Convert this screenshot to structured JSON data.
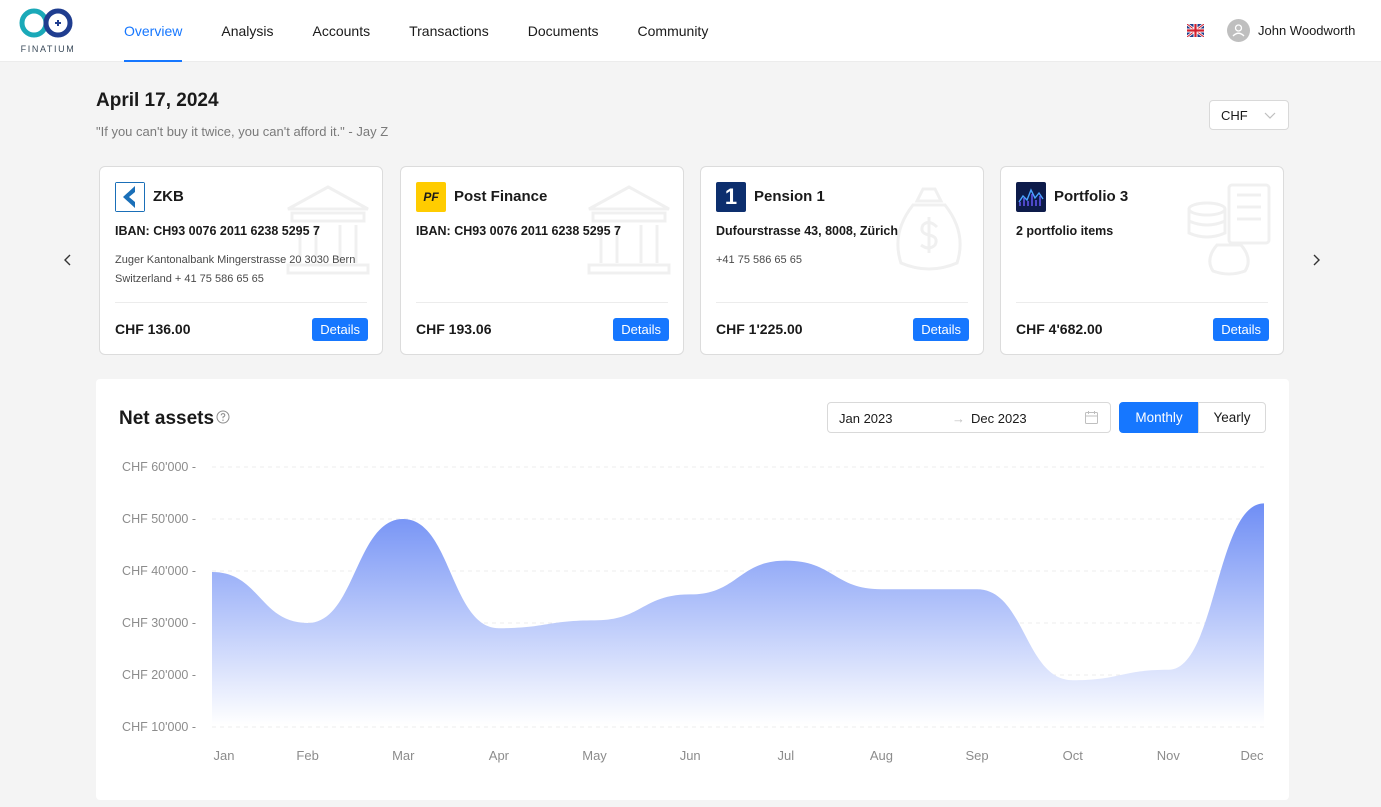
{
  "brand": {
    "name": "FINATIUM"
  },
  "nav": {
    "items": [
      {
        "label": "Overview",
        "active": true
      },
      {
        "label": "Analysis",
        "active": false
      },
      {
        "label": "Accounts",
        "active": false
      },
      {
        "label": "Transactions",
        "active": false
      },
      {
        "label": "Documents",
        "active": false
      },
      {
        "label": "Community",
        "active": false
      }
    ]
  },
  "user": {
    "name": "John Woodworth",
    "language_icon": "uk-flag-icon"
  },
  "header": {
    "date": "April 17, 2024",
    "quote": "\"If you can't buy it twice, you can't afford it.\" - Jay Z",
    "currency": "CHF"
  },
  "cards": [
    {
      "title": "ZKB",
      "line1": "IBAN: CH93 0076 2011 6238 5295 7",
      "line2": "Zuger Kantonalbank Mingerstrasse 20 3030 Bern Switzerland + 41 75 586 65 65",
      "amount": "CHF 136.00",
      "button": "Details",
      "icon": "zkb-logo-icon"
    },
    {
      "title": "Post Finance",
      "line1": "IBAN: CH93 0076 2011 6238 5295 7",
      "line2": "",
      "amount": "CHF 193.06",
      "button": "Details",
      "icon": "postfinance-logo-icon",
      "logo_text": "PF"
    },
    {
      "title": "Pension 1",
      "line1": "Dufourstrasse 43, 8008, Zürich",
      "line2": "+41 75 586 65 65",
      "amount": "CHF 1'225.00",
      "button": "Details",
      "icon": "pension-logo-icon",
      "logo_text": "1"
    },
    {
      "title": "Portfolio 3",
      "line1": "2 portfolio items",
      "line2": "",
      "amount": "CHF 4'682.00",
      "button": "Details",
      "icon": "portfolio-logo-icon"
    }
  ],
  "panel": {
    "title": "Net assets",
    "range_start": "Jan 2023",
    "range_arrow": "→",
    "range_end": "Dec 2023",
    "segments": [
      "Monthly",
      "Yearly"
    ],
    "selected_segment": "Monthly"
  },
  "colors": {
    "accent": "#1677ff",
    "area_top": "#6f8ef5",
    "area_bottom": "#ffffff"
  },
  "chart_data": {
    "type": "area",
    "categories": [
      "Jan",
      "Feb",
      "Mar",
      "Apr",
      "May",
      "Jun",
      "Jul",
      "Aug",
      "Sep",
      "Oct",
      "Nov",
      "Dec"
    ],
    "values": [
      39800,
      30000,
      50000,
      29000,
      30500,
      35500,
      42000,
      36500,
      36500,
      19000,
      21000,
      53000
    ],
    "yticks": [
      "CHF 60'000",
      "CHF 50'000",
      "CHF 40'000",
      "CHF 30'000",
      "CHF 20'000",
      "CHF 10'000"
    ],
    "ytick_values": [
      60000,
      50000,
      40000,
      30000,
      20000,
      10000
    ],
    "ylim": [
      10000,
      60000
    ],
    "grid": true
  }
}
